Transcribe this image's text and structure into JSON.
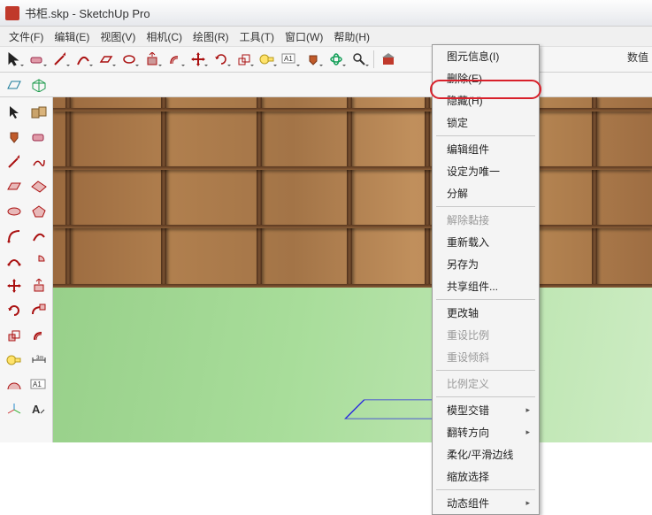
{
  "window": {
    "title": "书柜.skp - SketchUp Pro"
  },
  "menu": {
    "items": [
      "文件(F)",
      "编辑(E)",
      "视图(V)",
      "相机(C)",
      "绘图(R)",
      "工具(T)",
      "窗口(W)",
      "帮助(H)"
    ]
  },
  "toolbar_right_label": "数值",
  "context_menu": {
    "entity_info": "图元信息(I)",
    "delete": "删除(E)",
    "hide": "隐藏(H)",
    "lock": "锁定",
    "edit_component": "编辑组件",
    "make_unique": "设定为唯一",
    "explode": "分解",
    "unglue": "解除黏接",
    "reload": "重新载入",
    "save_as": "另存为",
    "share_component": "共享组件...",
    "change_axes": "更改轴",
    "reset_scale": "重设比例",
    "reset_skew": "重设倾斜",
    "scale_definition": "比例定义",
    "intersect": "模型交错",
    "flip": "翻转方向",
    "soften": "柔化/平滑边线",
    "zoom_selection": "缩放选择",
    "dynamic_components": "动态组件"
  }
}
